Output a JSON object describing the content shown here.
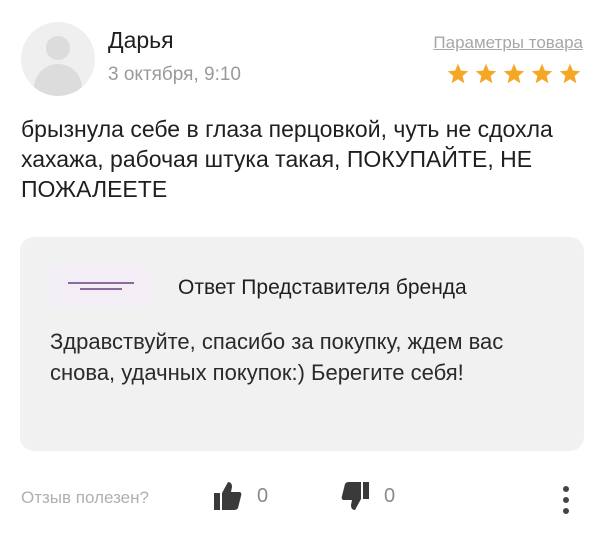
{
  "review": {
    "author": "Дарья",
    "date": "3 октября, 9:10",
    "product_params_link": "Параметры товара",
    "rating": 5,
    "star_color": "#f5a623",
    "text": "брызнула себе в глаза перцовкой, чуть не сдохла хахажа, рабочая штука такая, ПОКУПАЙТЕ, НЕ ПОЖАЛЕЕТЕ"
  },
  "brand_reply": {
    "title": "Ответ Представителя бренда",
    "text": "Здравствуйте, спасибо за покупку, ждем вас снова, удачных покупок:) Берегите себя!"
  },
  "feedback": {
    "helpful_label": "Отзыв полезен?",
    "likes": "0",
    "dislikes": "0",
    "like_icon": "thumbs-up-icon",
    "dislike_icon": "thumbs-down-icon"
  }
}
